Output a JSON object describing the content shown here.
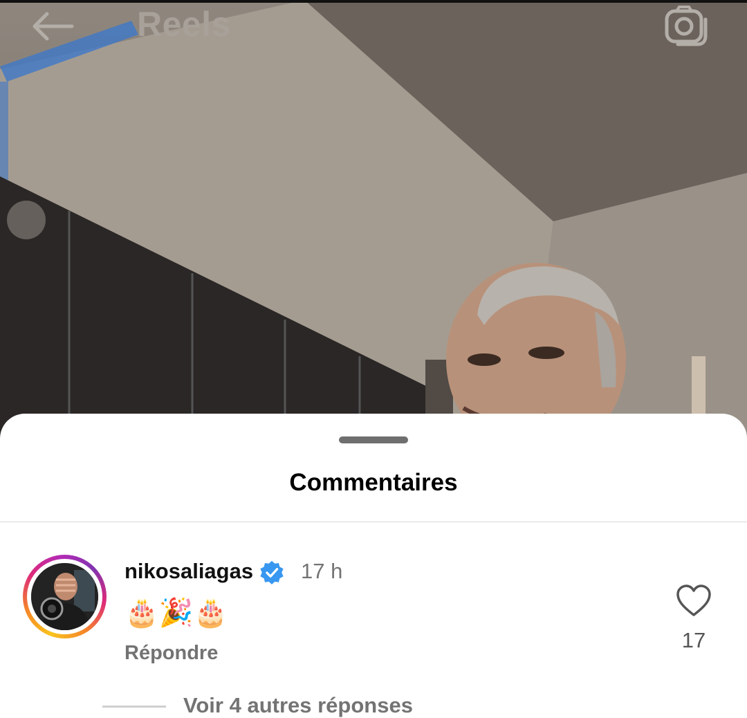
{
  "header": {
    "title": "Reels",
    "back_icon": "arrow-left-icon",
    "camera_icon": "camera-icon"
  },
  "sheet": {
    "title": "Commentaires"
  },
  "comment": {
    "username": "nikosaliagas",
    "verified": true,
    "time": "17 h",
    "text": "🎂🎉🎂",
    "reply_label": "Répondre",
    "like_count": "17",
    "more_replies": "Voir 4 autres réponses"
  },
  "colors": {
    "verified_blue": "#3897f0",
    "secondary_text": "#737373",
    "ring_start": "#f9c31d",
    "ring_end": "#b32bb5"
  }
}
